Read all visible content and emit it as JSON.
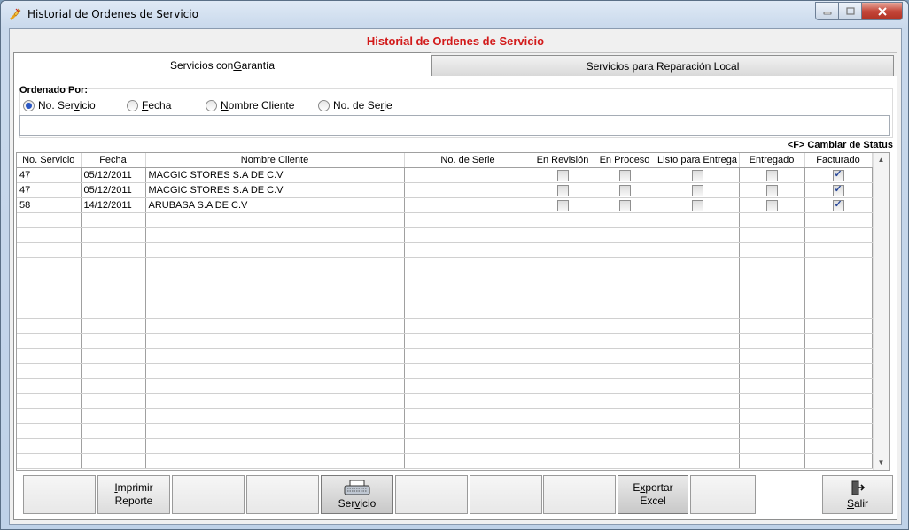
{
  "window": {
    "title": "Historial de Ordenes de Servicio",
    "accent": "#d21a1a"
  },
  "form": {
    "title": "Historial de Ordenes de Servicio"
  },
  "tabs": [
    {
      "label_pre": "Servicios con ",
      "label_u": "G",
      "label_post": "arantía"
    },
    {
      "label": "Servicios para Reparación Local"
    }
  ],
  "filter": {
    "label": "Ordenado Por:",
    "options": [
      {
        "pre": "No. Ser",
        "u": "v",
        "post": "icio",
        "selected": true
      },
      {
        "pre": "",
        "u": "F",
        "post": "echa",
        "selected": false
      },
      {
        "pre": "",
        "u": "N",
        "post": "ombre Cliente",
        "selected": false
      },
      {
        "pre": "No. de Se",
        "u": "r",
        "post": "ie",
        "selected": false
      }
    ],
    "search_value": ""
  },
  "status_hint": "<F> Cambiar de Status",
  "table": {
    "columns": [
      "No. Servicio",
      "Fecha",
      "Nombre Cliente",
      "No. de Serie",
      "En Revisión",
      "En Proceso",
      "Listo para Entrega",
      "Entregado",
      "Facturado"
    ],
    "rows": [
      {
        "servicio": "47",
        "fecha": "05/12/2011",
        "cliente": "MACGIC STORES S.A DE C.V",
        "serie": "",
        "revision": false,
        "proceso": false,
        "listo": false,
        "entregado": false,
        "facturado": true
      },
      {
        "servicio": "47",
        "fecha": "05/12/2011",
        "cliente": "MACGIC STORES S.A DE C.V",
        "serie": "",
        "revision": false,
        "proceso": false,
        "listo": false,
        "entregado": false,
        "facturado": true
      },
      {
        "servicio": "58",
        "fecha": "14/12/2011",
        "cliente": "ARUBASA S.A DE C.V",
        "serie": "",
        "revision": false,
        "proceso": false,
        "listo": false,
        "entregado": false,
        "facturado": true
      }
    ]
  },
  "buttons": {
    "imprimir_line1_u": "I",
    "imprimir_line1": "mprimir",
    "imprimir_line2": "Reporte",
    "servicio_pre": "Ser",
    "servicio_u": "v",
    "servicio_post": "icio",
    "exportar_pre": "E",
    "exportar_u": "x",
    "exportar_post": "portar",
    "exportar_line2": "Excel",
    "salir_u": "S",
    "salir_post": "alir"
  },
  "icons": {
    "app": "lightning-pen-icon",
    "printer": "printer-icon",
    "exit": "exit-door-icon"
  }
}
